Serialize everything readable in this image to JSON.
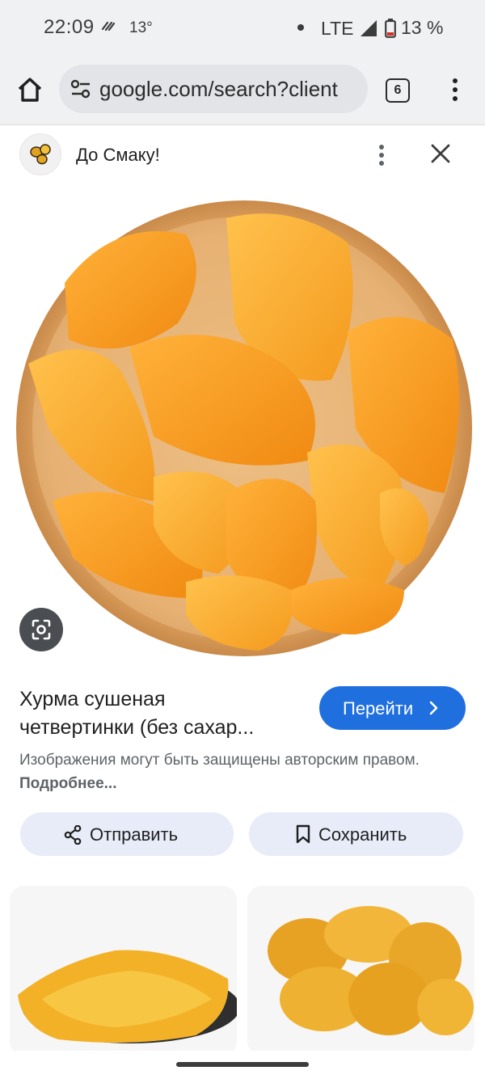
{
  "status_bar": {
    "time": "22:09",
    "temperature": "13°",
    "network": "LTE",
    "battery": "13 %"
  },
  "browser": {
    "url": "google.com/search?client",
    "tab_count": "6"
  },
  "source": {
    "name": "До Смаку!"
  },
  "result": {
    "title_line1": "Хурма сушеная",
    "title_line2": "четвертинки (без сахар...",
    "go_label": "Перейти",
    "copyright_text": "Изображения могут быть защищены авторским правом.",
    "more_link": "Подробнее..."
  },
  "actions": {
    "share_label": "Отправить",
    "save_label": "Сохранить"
  },
  "icons": {
    "home": "home-icon",
    "tune": "tune-icon",
    "tabs": "tabs-icon",
    "menu": "more-vert-icon",
    "close": "close-icon",
    "lens": "lens-icon",
    "share": "share-icon",
    "bookmark": "bookmark-icon"
  },
  "colors": {
    "accent": "#1f6fde",
    "action_bg": "#e7ecf8",
    "toolbar_bg": "#f0f1f3"
  }
}
